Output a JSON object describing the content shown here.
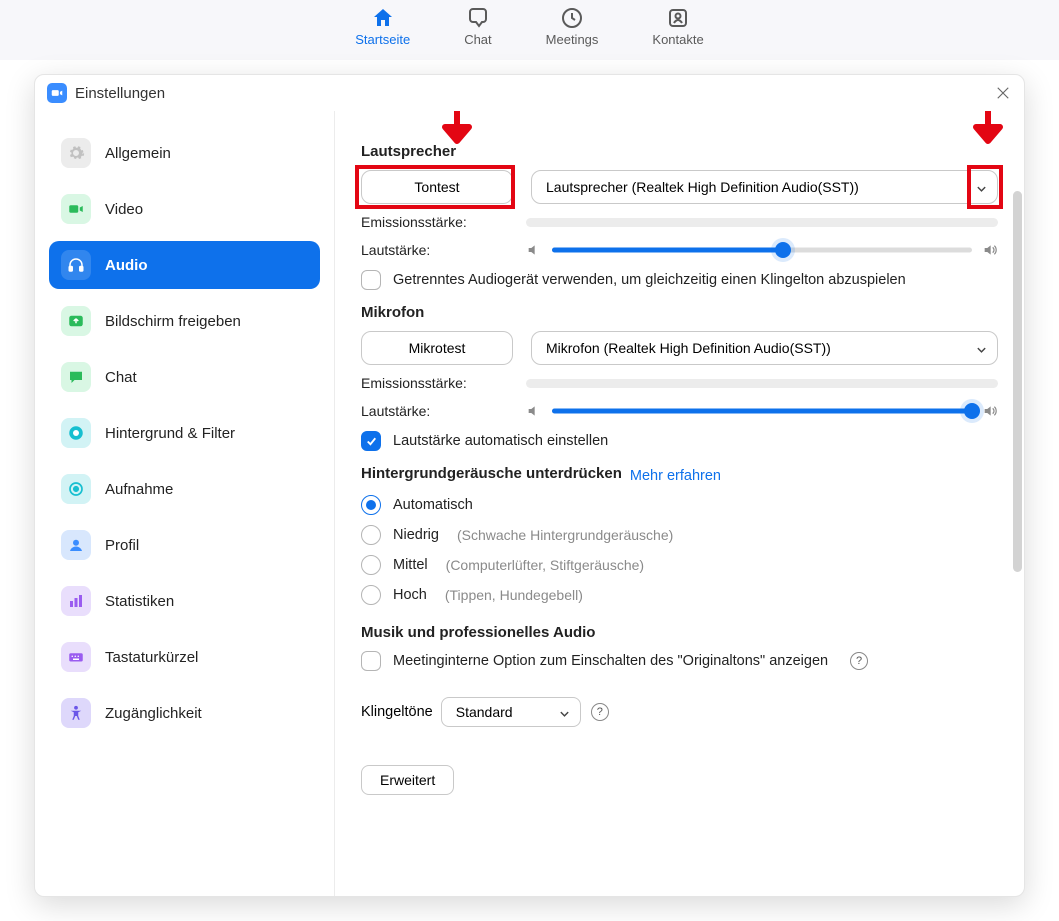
{
  "topnav": {
    "home": "Startseite",
    "chat": "Chat",
    "meetings": "Meetings",
    "contacts": "Kontakte"
  },
  "modal": {
    "title": "Einstellungen"
  },
  "sidebar": {
    "general": "Allgemein",
    "video": "Video",
    "audio": "Audio",
    "share": "Bildschirm freigeben",
    "chat": "Chat",
    "background": "Hintergrund & Filter",
    "recording": "Aufnahme",
    "profile": "Profil",
    "statistics": "Statistiken",
    "shortcuts": "Tastaturkürzel",
    "accessibility": "Zugänglichkeit"
  },
  "speaker": {
    "title": "Lautsprecher",
    "test_btn": "Tontest",
    "device": "Lautsprecher (Realtek High Definition Audio(SST))",
    "output_label": "Emissionsstärke:",
    "volume_label": "Lautstärke:",
    "volume_percent": 55,
    "separate_audio": "Getrenntes Audiogerät verwenden, um gleichzeitig einen Klingelton abzuspielen"
  },
  "mic": {
    "title": "Mikrofon",
    "test_btn": "Mikrotest",
    "device": "Mikrofon (Realtek High Definition Audio(SST))",
    "input_label": "Emissionsstärke:",
    "volume_label": "Lautstärke:",
    "volume_percent": 100,
    "auto_adjust": "Lautstärke automatisch einstellen"
  },
  "noise": {
    "title": "Hintergrundgeräusche unterdrücken",
    "learn": "Mehr erfahren",
    "auto": "Automatisch",
    "low": "Niedrig",
    "low_hint": "(Schwache Hintergrundgeräusche)",
    "medium": "Mittel",
    "medium_hint": "(Computerlüfter, Stiftgeräusche)",
    "high": "Hoch",
    "high_hint": "(Tippen, Hundegebell)"
  },
  "music": {
    "title": "Musik und professionelles Audio",
    "original_sound": "Meetinginterne Option zum Einschalten des \"Originaltons\" anzeigen"
  },
  "ringtone": {
    "label": "Klingeltöne",
    "value": "Standard"
  },
  "advanced_btn": "Erweitert",
  "help_glyph": "?"
}
